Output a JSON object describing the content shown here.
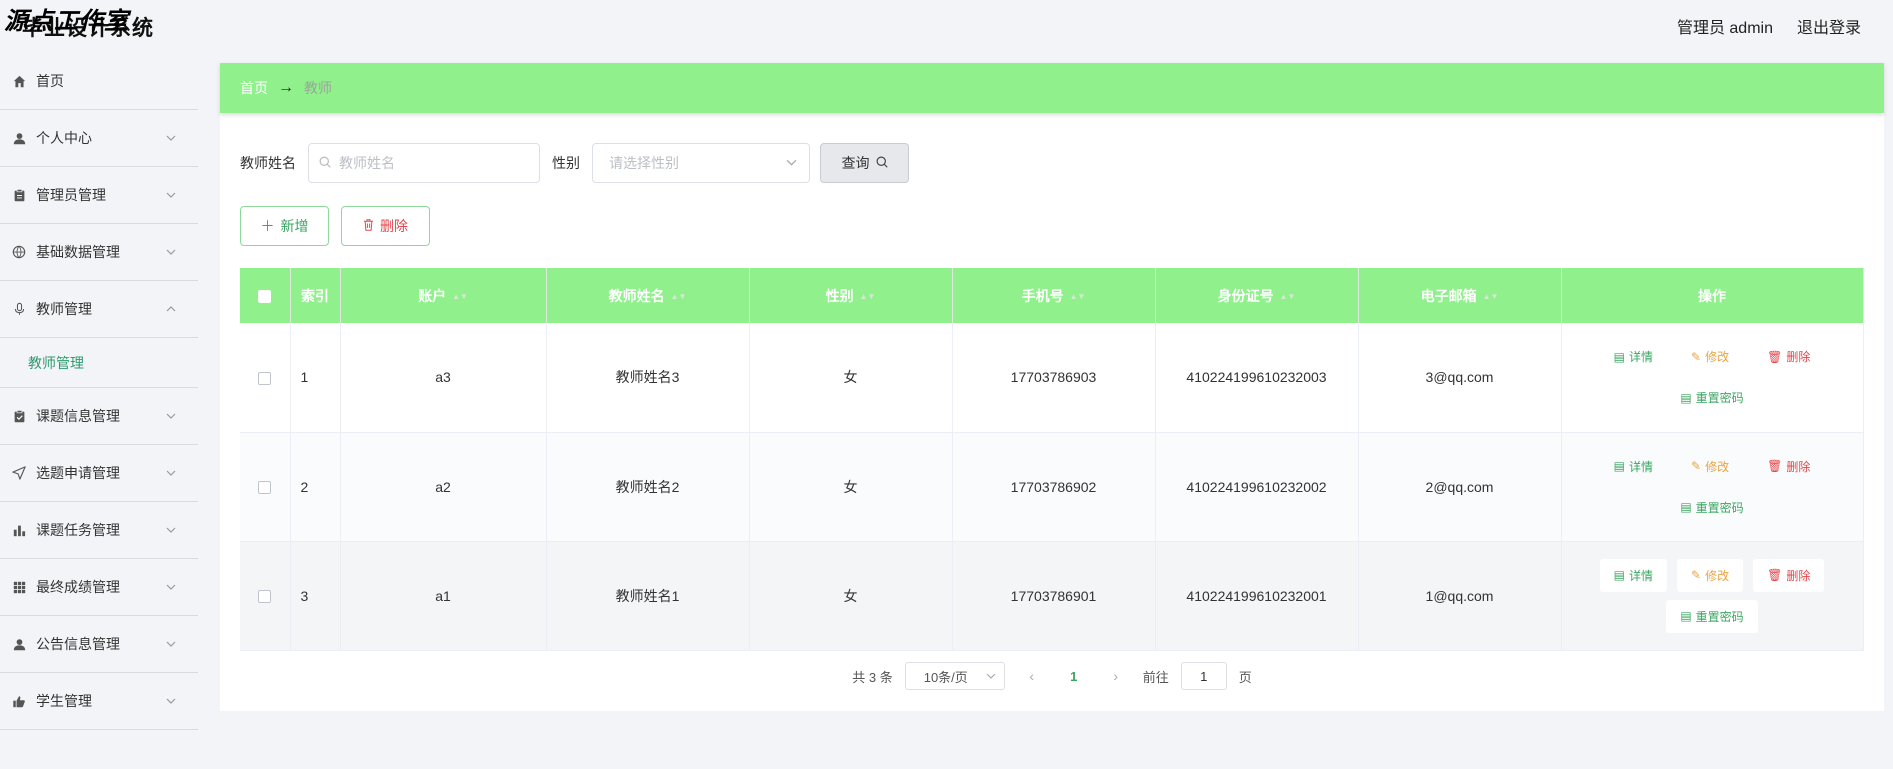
{
  "brand": {
    "title": "毕业设计系统",
    "watermark": "源点工作室"
  },
  "topbar": {
    "user": "管理员 admin",
    "logout": "退出登录"
  },
  "sidebar": {
    "items": [
      {
        "label": "首页",
        "icon": "home-icon"
      },
      {
        "label": "个人中心",
        "icon": "user-icon"
      },
      {
        "label": "管理员管理",
        "icon": "clipboard-icon"
      },
      {
        "label": "基础数据管理",
        "icon": "globe-icon"
      },
      {
        "label": "教师管理",
        "icon": "mic-icon"
      },
      {
        "label": "课题信息管理",
        "icon": "checklist-icon"
      },
      {
        "label": "选题申请管理",
        "icon": "send-icon"
      },
      {
        "label": "课题任务管理",
        "icon": "bar-chart-icon"
      },
      {
        "label": "最终成绩管理",
        "icon": "grid-icon"
      },
      {
        "label": "公告信息管理",
        "icon": "user-icon"
      },
      {
        "label": "学生管理",
        "icon": "thumb-icon"
      }
    ],
    "sub_active": "教师管理"
  },
  "breadcrumb": {
    "home": "首页",
    "arrow": "→",
    "current": "教师"
  },
  "search": {
    "name_label": "教师姓名",
    "name_placeholder": "教师姓名",
    "gender_label": "性别",
    "gender_placeholder": "请选择性别",
    "query_label": "查询"
  },
  "actions": {
    "add": "新增",
    "delete": "删除"
  },
  "table": {
    "headers": [
      "索引",
      "账户",
      "教师姓名",
      "性别",
      "手机号",
      "身份证号",
      "电子邮箱",
      "操作"
    ],
    "rows": [
      {
        "index": "1",
        "account": "a3",
        "name": "教师姓名3",
        "gender": "女",
        "phone": "17703786903",
        "id_card": "410224199610232003",
        "email": "3@qq.com"
      },
      {
        "index": "2",
        "account": "a2",
        "name": "教师姓名2",
        "gender": "女",
        "phone": "17703786902",
        "id_card": "410224199610232002",
        "email": "2@qq.com"
      },
      {
        "index": "3",
        "account": "a1",
        "name": "教师姓名1",
        "gender": "女",
        "phone": "17703786901",
        "id_card": "410224199610232001",
        "email": "1@qq.com"
      }
    ],
    "ops": {
      "detail": "详情",
      "edit": "修改",
      "remove": "删除",
      "reset": "重置密码"
    }
  },
  "pagination": {
    "total": "共 3 条",
    "page_size": "10条/页",
    "current": "1",
    "goto_label": "前往",
    "goto_value": "1",
    "page_unit": "页"
  }
}
